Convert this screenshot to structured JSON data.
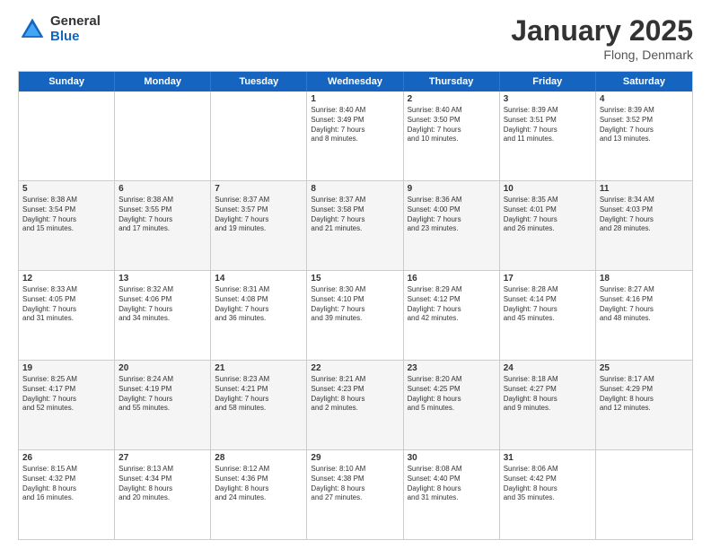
{
  "logo": {
    "general": "General",
    "blue": "Blue"
  },
  "title": {
    "month": "January 2025",
    "location": "Flong, Denmark"
  },
  "header_days": [
    "Sunday",
    "Monday",
    "Tuesday",
    "Wednesday",
    "Thursday",
    "Friday",
    "Saturday"
  ],
  "weeks": [
    {
      "alt": false,
      "cells": [
        {
          "day": "",
          "lines": []
        },
        {
          "day": "",
          "lines": []
        },
        {
          "day": "",
          "lines": []
        },
        {
          "day": "1",
          "lines": [
            "Sunrise: 8:40 AM",
            "Sunset: 3:49 PM",
            "Daylight: 7 hours",
            "and 8 minutes."
          ]
        },
        {
          "day": "2",
          "lines": [
            "Sunrise: 8:40 AM",
            "Sunset: 3:50 PM",
            "Daylight: 7 hours",
            "and 10 minutes."
          ]
        },
        {
          "day": "3",
          "lines": [
            "Sunrise: 8:39 AM",
            "Sunset: 3:51 PM",
            "Daylight: 7 hours",
            "and 11 minutes."
          ]
        },
        {
          "day": "4",
          "lines": [
            "Sunrise: 8:39 AM",
            "Sunset: 3:52 PM",
            "Daylight: 7 hours",
            "and 13 minutes."
          ]
        }
      ]
    },
    {
      "alt": true,
      "cells": [
        {
          "day": "5",
          "lines": [
            "Sunrise: 8:38 AM",
            "Sunset: 3:54 PM",
            "Daylight: 7 hours",
            "and 15 minutes."
          ]
        },
        {
          "day": "6",
          "lines": [
            "Sunrise: 8:38 AM",
            "Sunset: 3:55 PM",
            "Daylight: 7 hours",
            "and 17 minutes."
          ]
        },
        {
          "day": "7",
          "lines": [
            "Sunrise: 8:37 AM",
            "Sunset: 3:57 PM",
            "Daylight: 7 hours",
            "and 19 minutes."
          ]
        },
        {
          "day": "8",
          "lines": [
            "Sunrise: 8:37 AM",
            "Sunset: 3:58 PM",
            "Daylight: 7 hours",
            "and 21 minutes."
          ]
        },
        {
          "day": "9",
          "lines": [
            "Sunrise: 8:36 AM",
            "Sunset: 4:00 PM",
            "Daylight: 7 hours",
            "and 23 minutes."
          ]
        },
        {
          "day": "10",
          "lines": [
            "Sunrise: 8:35 AM",
            "Sunset: 4:01 PM",
            "Daylight: 7 hours",
            "and 26 minutes."
          ]
        },
        {
          "day": "11",
          "lines": [
            "Sunrise: 8:34 AM",
            "Sunset: 4:03 PM",
            "Daylight: 7 hours",
            "and 28 minutes."
          ]
        }
      ]
    },
    {
      "alt": false,
      "cells": [
        {
          "day": "12",
          "lines": [
            "Sunrise: 8:33 AM",
            "Sunset: 4:05 PM",
            "Daylight: 7 hours",
            "and 31 minutes."
          ]
        },
        {
          "day": "13",
          "lines": [
            "Sunrise: 8:32 AM",
            "Sunset: 4:06 PM",
            "Daylight: 7 hours",
            "and 34 minutes."
          ]
        },
        {
          "day": "14",
          "lines": [
            "Sunrise: 8:31 AM",
            "Sunset: 4:08 PM",
            "Daylight: 7 hours",
            "and 36 minutes."
          ]
        },
        {
          "day": "15",
          "lines": [
            "Sunrise: 8:30 AM",
            "Sunset: 4:10 PM",
            "Daylight: 7 hours",
            "and 39 minutes."
          ]
        },
        {
          "day": "16",
          "lines": [
            "Sunrise: 8:29 AM",
            "Sunset: 4:12 PM",
            "Daylight: 7 hours",
            "and 42 minutes."
          ]
        },
        {
          "day": "17",
          "lines": [
            "Sunrise: 8:28 AM",
            "Sunset: 4:14 PM",
            "Daylight: 7 hours",
            "and 45 minutes."
          ]
        },
        {
          "day": "18",
          "lines": [
            "Sunrise: 8:27 AM",
            "Sunset: 4:16 PM",
            "Daylight: 7 hours",
            "and 48 minutes."
          ]
        }
      ]
    },
    {
      "alt": true,
      "cells": [
        {
          "day": "19",
          "lines": [
            "Sunrise: 8:25 AM",
            "Sunset: 4:17 PM",
            "Daylight: 7 hours",
            "and 52 minutes."
          ]
        },
        {
          "day": "20",
          "lines": [
            "Sunrise: 8:24 AM",
            "Sunset: 4:19 PM",
            "Daylight: 7 hours",
            "and 55 minutes."
          ]
        },
        {
          "day": "21",
          "lines": [
            "Sunrise: 8:23 AM",
            "Sunset: 4:21 PM",
            "Daylight: 7 hours",
            "and 58 minutes."
          ]
        },
        {
          "day": "22",
          "lines": [
            "Sunrise: 8:21 AM",
            "Sunset: 4:23 PM",
            "Daylight: 8 hours",
            "and 2 minutes."
          ]
        },
        {
          "day": "23",
          "lines": [
            "Sunrise: 8:20 AM",
            "Sunset: 4:25 PM",
            "Daylight: 8 hours",
            "and 5 minutes."
          ]
        },
        {
          "day": "24",
          "lines": [
            "Sunrise: 8:18 AM",
            "Sunset: 4:27 PM",
            "Daylight: 8 hours",
            "and 9 minutes."
          ]
        },
        {
          "day": "25",
          "lines": [
            "Sunrise: 8:17 AM",
            "Sunset: 4:29 PM",
            "Daylight: 8 hours",
            "and 12 minutes."
          ]
        }
      ]
    },
    {
      "alt": false,
      "cells": [
        {
          "day": "26",
          "lines": [
            "Sunrise: 8:15 AM",
            "Sunset: 4:32 PM",
            "Daylight: 8 hours",
            "and 16 minutes."
          ]
        },
        {
          "day": "27",
          "lines": [
            "Sunrise: 8:13 AM",
            "Sunset: 4:34 PM",
            "Daylight: 8 hours",
            "and 20 minutes."
          ]
        },
        {
          "day": "28",
          "lines": [
            "Sunrise: 8:12 AM",
            "Sunset: 4:36 PM",
            "Daylight: 8 hours",
            "and 24 minutes."
          ]
        },
        {
          "day": "29",
          "lines": [
            "Sunrise: 8:10 AM",
            "Sunset: 4:38 PM",
            "Daylight: 8 hours",
            "and 27 minutes."
          ]
        },
        {
          "day": "30",
          "lines": [
            "Sunrise: 8:08 AM",
            "Sunset: 4:40 PM",
            "Daylight: 8 hours",
            "and 31 minutes."
          ]
        },
        {
          "day": "31",
          "lines": [
            "Sunrise: 8:06 AM",
            "Sunset: 4:42 PM",
            "Daylight: 8 hours",
            "and 35 minutes."
          ]
        },
        {
          "day": "",
          "lines": []
        }
      ]
    }
  ]
}
